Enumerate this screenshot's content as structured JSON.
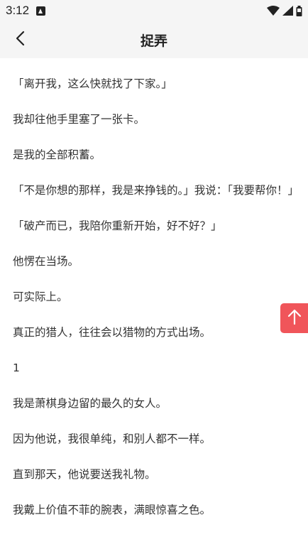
{
  "status_bar": {
    "time": "3:12",
    "icons": [
      "app-notification-icon",
      "wifi-icon",
      "signal-icon",
      "battery-icon"
    ]
  },
  "header": {
    "title": "捉弄",
    "back_icon": "chevron-left-icon"
  },
  "paragraphs": [
    "「离开我，这么快就找了下家。」",
    "我却往他手里塞了一张卡。",
    "是我的全部积蓄。",
    "「不是你想的那样，我是来挣钱的。」我说：「我要帮你！」",
    "「破产而已，我陪你重新开始，好不好？」",
    "他愣在当场。",
    "可实际上。",
    "真正的猎人，往往会以猎物的方式出场。",
    "1",
    "我是萧棋身边留的最久的女人。",
    "因为他说，我很单纯，和别人都不一样。",
    "直到那天，他说要送我礼物。",
    "我戴上价值不菲的腕表，满眼惊喜之色。"
  ],
  "scroll_top": {
    "icon": "arrow-up-icon",
    "color": "#f0555a"
  },
  "colors": {
    "header_bg": "#f5f5f5",
    "text": "#333333",
    "accent": "#f0555a"
  }
}
